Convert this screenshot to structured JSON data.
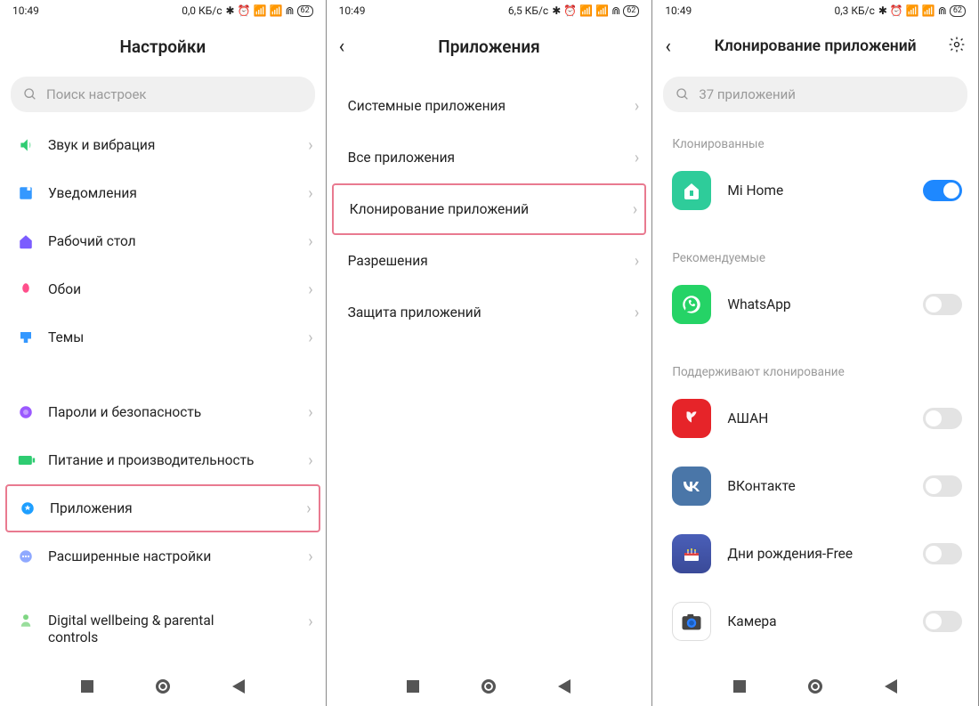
{
  "screen1": {
    "status": {
      "time": "10:49",
      "net": "0,0 КБ/с",
      "battery": "62"
    },
    "title": "Настройки",
    "search_placeholder": "Поиск настроек",
    "items": [
      {
        "label": "Звук и вибрация"
      },
      {
        "label": "Уведомления"
      },
      {
        "label": "Рабочий стол"
      },
      {
        "label": "Обои"
      },
      {
        "label": "Темы"
      }
    ],
    "items2": [
      {
        "label": "Пароли и безопасность"
      },
      {
        "label": "Питание и производительность"
      },
      {
        "label": "Приложения",
        "highlighted": true
      },
      {
        "label": "Расширенные настройки"
      }
    ],
    "items3": [
      {
        "label": "Digital wellbeing & parental",
        "sub": "controls"
      }
    ]
  },
  "screen2": {
    "status": {
      "time": "10:49",
      "net": "6,5 КБ/с",
      "battery": "62"
    },
    "title": "Приложения",
    "items": [
      {
        "label": "Системные приложения"
      },
      {
        "label": "Все приложения"
      },
      {
        "label": "Клонирование приложений",
        "highlighted": true
      },
      {
        "label": "Разрешения"
      },
      {
        "label": "Защита приложений"
      }
    ]
  },
  "screen3": {
    "status": {
      "time": "10:49",
      "net": "0,3 КБ/с",
      "battery": "62"
    },
    "title": "Клонирование приложений",
    "search_placeholder": "37 приложений",
    "sections": {
      "cloned": {
        "label": "Клонированные",
        "items": [
          {
            "label": "Mi Home",
            "on": true
          }
        ]
      },
      "rec": {
        "label": "Рекомендуемые",
        "items": [
          {
            "label": "WhatsApp",
            "on": false
          }
        ]
      },
      "support": {
        "label": "Поддерживают клонирование",
        "items": [
          {
            "label": "АШАН",
            "on": false
          },
          {
            "label": "ВКонтакте",
            "on": false
          },
          {
            "label": "Дни рождения-Free",
            "on": false
          },
          {
            "label": "Камера",
            "on": false
          }
        ]
      }
    }
  }
}
